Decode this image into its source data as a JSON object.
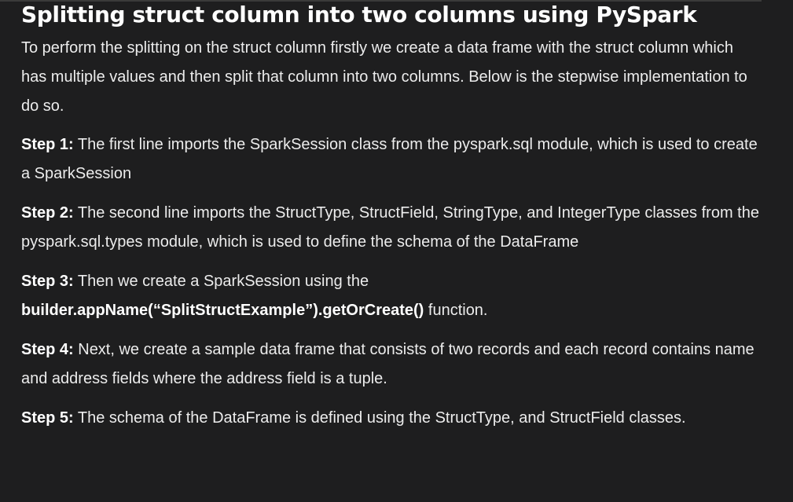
{
  "article": {
    "title": "Splitting struct column into two columns using PySpark",
    "intro": "To perform the splitting on the struct column firstly we create a data frame with the struct column which has multiple values and then split that column into two columns. Below is the stepwise implementation to do so.",
    "steps": [
      {
        "label": "Step 1:",
        "text": " The first line imports the SparkSession class from the pyspark.sql module, which is used to create a SparkSession"
      },
      {
        "label": "Step 2:",
        "text": " The second line imports the StructType, StructField, StringType, and IntegerType classes from the pyspark.sql.types module, which is used to define the schema of the DataFrame"
      },
      {
        "label": "Step 3:",
        "text": " Then we create a SparkSession using the ",
        "code": "builder.appName(“SplitStructExample”).getOrCreate()",
        "suffix": " function."
      },
      {
        "label": "Step 4:",
        "text": " Next, we create a sample data frame that consists of two records and each record contains name and address fields where the address field is a tuple."
      },
      {
        "label": "Step 5:",
        "text": " The schema of the DataFrame is defined using the StructType, and StructField classes."
      }
    ]
  }
}
